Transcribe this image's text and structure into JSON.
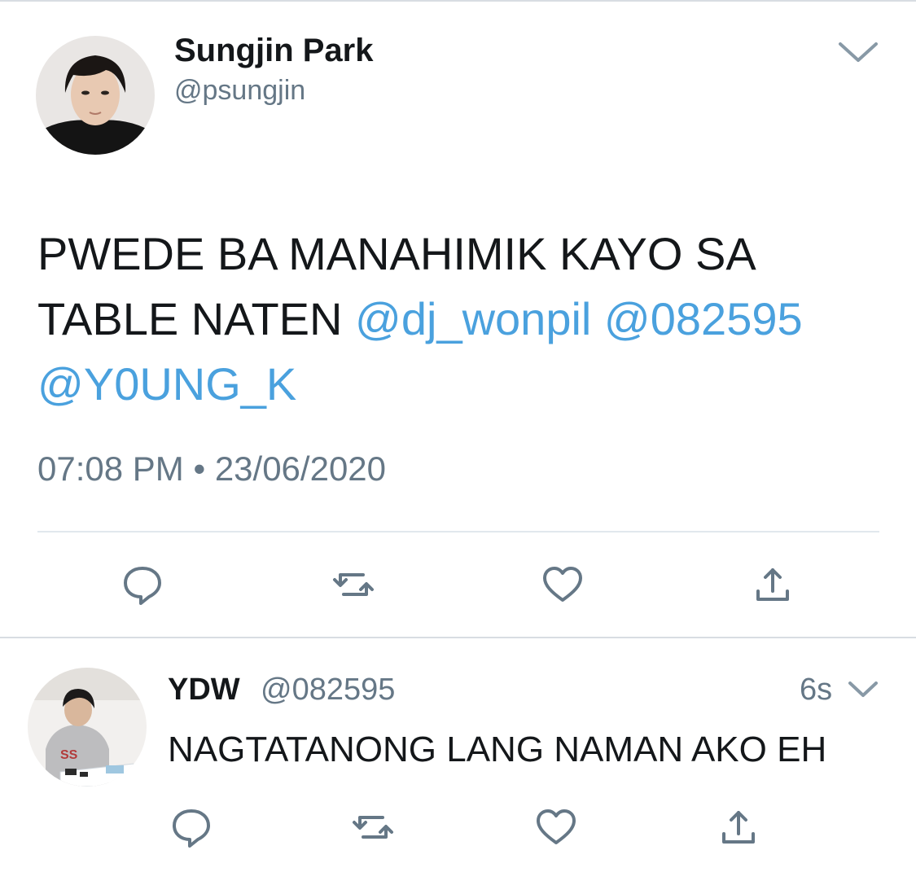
{
  "tweet": {
    "author_name": "Sungjin Park",
    "author_handle": "@psungjin",
    "text_plain": "PWEDE BA MANAHIMIK KAYO SA TABLE NATEN",
    "mentions": [
      "@dj_wonpil",
      "@082595",
      "@Y0UNG_K"
    ],
    "timestamp": "07:08 PM • 23/06/2020",
    "more_icon": "chevron-down-icon"
  },
  "actions": {
    "icons": [
      "reply-icon",
      "retweet-icon",
      "like-icon",
      "share-icon"
    ]
  },
  "reply": {
    "author_name": "YDW",
    "author_handle": "@082595",
    "time": "6s",
    "text": "NAGTATANONG LANG NAMAN AKO EH",
    "more_icon": "chevron-down-icon"
  },
  "colors": {
    "mention": "#4aa1de",
    "secondary_text": "#657786",
    "primary_text": "#14171a",
    "icon": "#657786"
  }
}
